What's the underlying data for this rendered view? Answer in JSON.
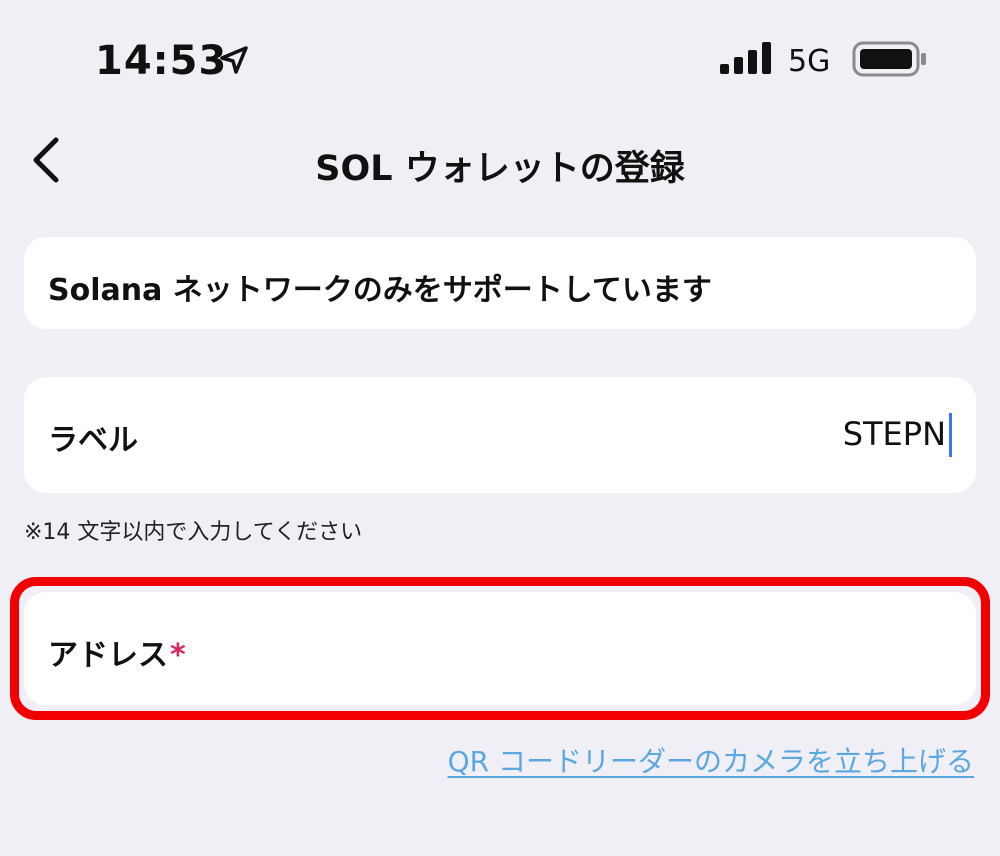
{
  "status_bar": {
    "time": "14:53",
    "network": "5G",
    "icons": [
      "location-arrow-icon",
      "signal-bars-icon",
      "battery-icon"
    ]
  },
  "nav": {
    "title": "SOL ウォレットの登録",
    "back_icon": "chevron-left-icon"
  },
  "info": {
    "text": "Solana ネットワークのみをサポートしています"
  },
  "label_field": {
    "label": "ラベル",
    "value": "STEPN"
  },
  "hint": "※14 文字以内で入力してください",
  "address_field": {
    "label": "アドレス",
    "required_mark": "*",
    "value": ""
  },
  "qr_link": "QR コードリーダーのカメラを立ち上げる",
  "colors": {
    "background": "#f0eff5",
    "card": "#ffffff",
    "highlight": "#f20000",
    "required": "#e0245e",
    "link": "#5ba8e0",
    "caret": "#3478f6"
  }
}
